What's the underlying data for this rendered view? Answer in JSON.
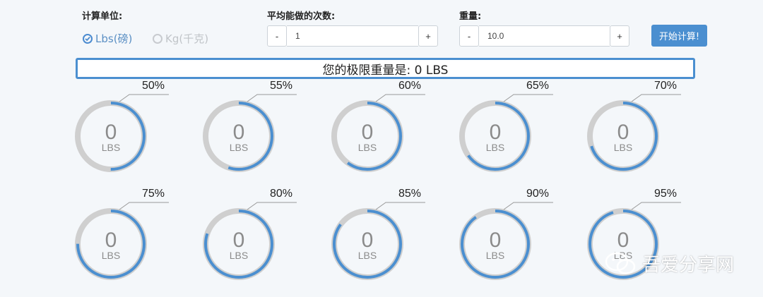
{
  "form": {
    "unit_label": "计算单位:",
    "unit_options": [
      {
        "label": "Lbs(磅)",
        "selected": true
      },
      {
        "label": "Kg(千克)",
        "selected": false
      }
    ],
    "reps_label": "平均能做的次数:",
    "reps_value": "1",
    "weight_label": "重量:",
    "weight_value": "10.0",
    "minus": "-",
    "plus": "+",
    "calc_button": "开始计算!"
  },
  "result_text": "您的极限重量是: 0 LBS",
  "rings": [
    {
      "pct_label": "50%",
      "fraction": 0.5,
      "value": "0",
      "unit": "LBS"
    },
    {
      "pct_label": "55%",
      "fraction": 0.55,
      "value": "0",
      "unit": "LBS"
    },
    {
      "pct_label": "60%",
      "fraction": 0.6,
      "value": "0",
      "unit": "LBS"
    },
    {
      "pct_label": "65%",
      "fraction": 0.65,
      "value": "0",
      "unit": "LBS"
    },
    {
      "pct_label": "70%",
      "fraction": 0.7,
      "value": "0",
      "unit": "LBS"
    },
    {
      "pct_label": "75%",
      "fraction": 0.75,
      "value": "0",
      "unit": "LBS"
    },
    {
      "pct_label": "80%",
      "fraction": 0.8,
      "value": "0",
      "unit": "LBS"
    },
    {
      "pct_label": "85%",
      "fraction": 0.85,
      "value": "0",
      "unit": "LBS"
    },
    {
      "pct_label": "90%",
      "fraction": 0.9,
      "value": "0",
      "unit": "LBS"
    },
    {
      "pct_label": "95%",
      "fraction": 0.95,
      "value": "0",
      "unit": "LBS"
    }
  ],
  "watermark_text": "吾爱分享网",
  "colors": {
    "accent": "#4b8fd0",
    "track": "#cfcfcf",
    "page_bg": "#f4f7fa"
  }
}
